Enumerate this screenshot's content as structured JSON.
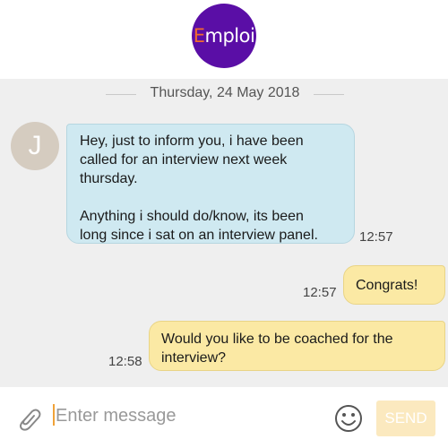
{
  "header": {
    "logo_first_letter": "E",
    "logo_rest": "mploi",
    "logo_colors": {
      "background": "#5a0ea6",
      "accent": "#f26a2e"
    }
  },
  "chat": {
    "date_separator": "Thursday, 24 May 2018",
    "messages": [
      {
        "direction": "incoming",
        "avatar_letter": "J",
        "paragraph1": [
          "Hey, just to inform you, i have been",
          "called for an interview next week",
          "thursday."
        ],
        "paragraph2": [
          "Anything i should do/know, its been",
          "long since i sat on an interview panel."
        ],
        "time": "12:57",
        "bubble_color": "#cfe9f1"
      },
      {
        "direction": "outgoing",
        "lines": [
          "Congrats!"
        ],
        "time": "12:57",
        "bubble_color": "#fbe9a4"
      },
      {
        "direction": "outgoing",
        "lines": [
          "Would you like to be coached for the",
          "interview?"
        ],
        "time": "12:58",
        "bubble_color": "#fbe9a4"
      }
    ]
  },
  "composer": {
    "attach_icon": "paperclip-icon",
    "placeholder": "Enter message",
    "value": "",
    "emoji_icon": "smiley-icon",
    "send_label": "SEND",
    "send_state": "disabled"
  }
}
